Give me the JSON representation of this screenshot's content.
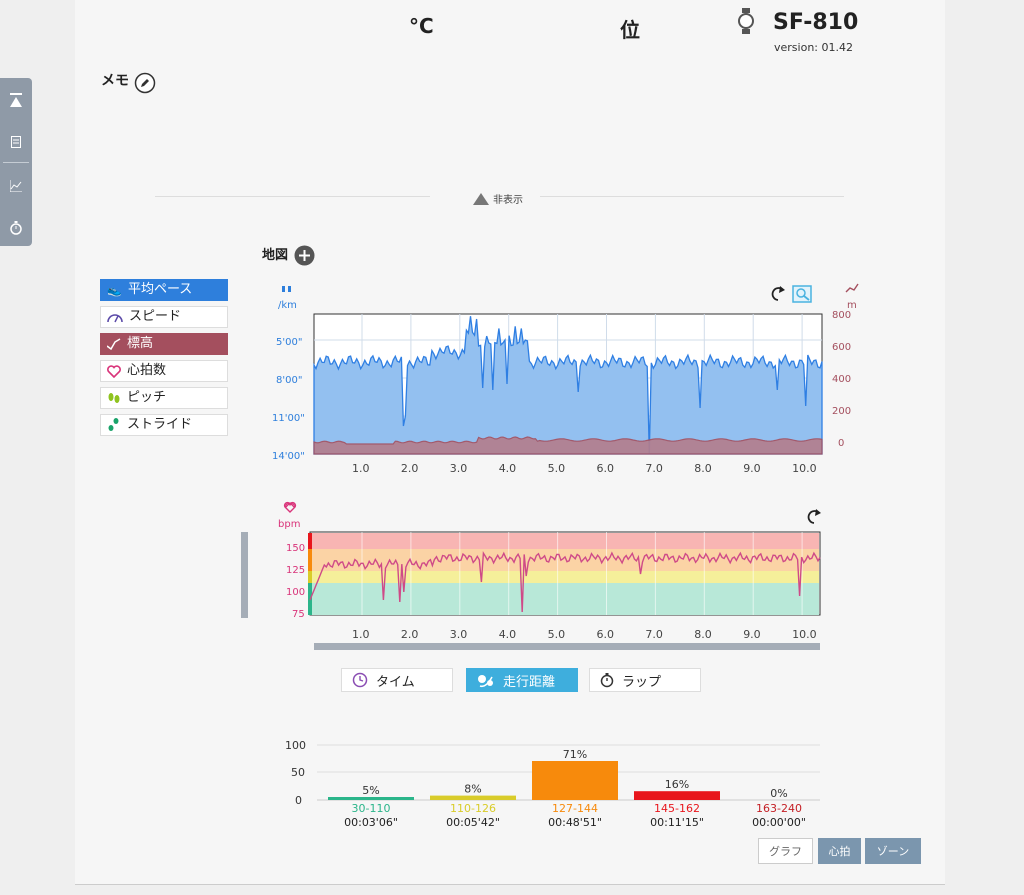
{
  "header": {
    "temperature_unit": "°C",
    "rank_label": "位",
    "device_name": "SF-810",
    "version": "version: 01.42"
  },
  "memo": {
    "label": "メモ"
  },
  "toggle": {
    "hide_label": "非表示"
  },
  "map": {
    "label": "地図"
  },
  "legend": {
    "items": [
      {
        "label": "平均ペース"
      },
      {
        "label": "スピード"
      },
      {
        "label": "標高"
      },
      {
        "label": "心拍数"
      },
      {
        "label": "ピッチ"
      },
      {
        "label": "ストライド"
      }
    ]
  },
  "pace_chart": {
    "y_left_unit": "/km",
    "y_right_unit": "m",
    "y_left_ticks": [
      "5'00\"",
      "8'00\"",
      "11'00\"",
      "14'00\""
    ],
    "y_right_ticks": [
      "800",
      "600",
      "400",
      "200",
      "0"
    ],
    "x_ticks": [
      "1.0",
      "2.0",
      "3.0",
      "4.0",
      "5.0",
      "6.0",
      "7.0",
      "8.0",
      "9.0",
      "10.0"
    ]
  },
  "hr_chart": {
    "y_unit": "bpm",
    "y_ticks": [
      "150",
      "125",
      "100",
      "75"
    ],
    "x_ticks": [
      "1.0",
      "2.0",
      "3.0",
      "4.0",
      "5.0",
      "6.0",
      "7.0",
      "8.0",
      "9.0",
      "10.0"
    ]
  },
  "tabs": {
    "time": "タイム",
    "distance": "走行距離",
    "lap": "ラップ"
  },
  "chart_data": {
    "type": "bar",
    "categories": [
      "30-110",
      "110-126",
      "127-144",
      "145-162",
      "163-240"
    ],
    "values": [
      5,
      8,
      71,
      16,
      0
    ],
    "value_labels": [
      "5%",
      "8%",
      "71%",
      "16%",
      "0%"
    ],
    "durations": [
      "00:03'06\"",
      "00:05'42\"",
      "00:48'51\"",
      "00:11'15\"",
      "00:00'00\""
    ],
    "colors": [
      "#2bb58a",
      "#d9cc2a",
      "#f78a0c",
      "#e8161c",
      "#c41f25"
    ],
    "y_ticks": [
      "100",
      "50",
      "0"
    ],
    "ylim": [
      0,
      100
    ],
    "title": "",
    "xlabel": "",
    "ylabel": ""
  },
  "bottom_buttons": {
    "graph": "グラフ",
    "heart": "心拍",
    "zone": "ゾーン"
  }
}
